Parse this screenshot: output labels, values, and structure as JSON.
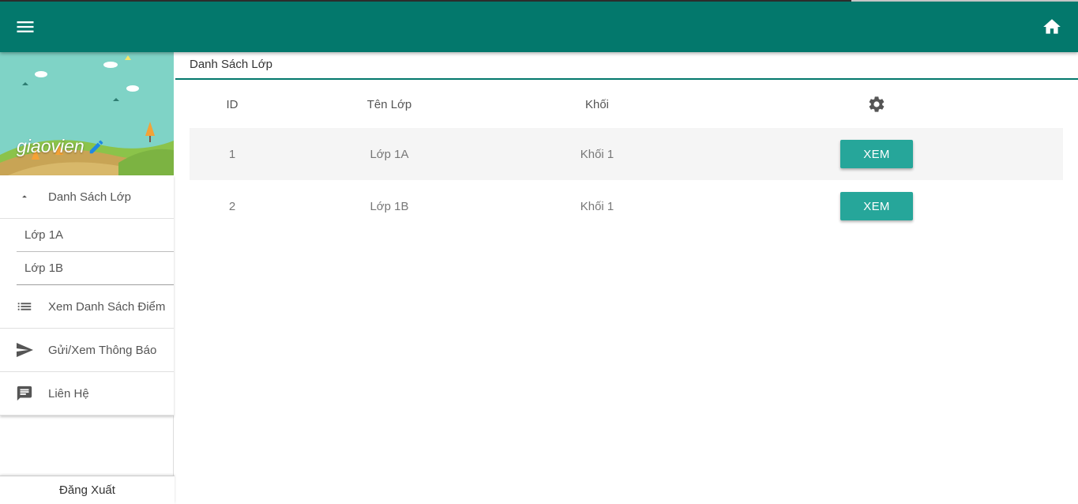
{
  "user": {
    "name": "giaovien"
  },
  "sidebar": {
    "items": [
      {
        "label": "Danh Sách Lớp",
        "icon": "arrow-up-icon"
      },
      {
        "label": "Xem Danh Sách Điểm",
        "icon": "list-icon"
      },
      {
        "label": "Gửi/Xem Thông Báo",
        "icon": "send-icon"
      },
      {
        "label": "Liên Hệ",
        "icon": "message-icon"
      }
    ],
    "subitems": [
      {
        "label": "Lớp 1A"
      },
      {
        "label": "Lớp 1B"
      }
    ],
    "logout_label": "Đăng Xuất"
  },
  "main": {
    "title": "Danh Sách Lớp",
    "table": {
      "headers": [
        "ID",
        "Tên Lớp",
        "Khối"
      ],
      "settings_icon": "gear-icon",
      "rows": [
        {
          "id": "1",
          "name": "Lớp 1A",
          "grade": "Khối 1",
          "action": "XEM"
        },
        {
          "id": "2",
          "name": "Lớp 1B",
          "grade": "Khối 1",
          "action": "XEM"
        }
      ]
    }
  },
  "colors": {
    "appbar": "#03786c",
    "button": "#26a69a",
    "row_shade": "#f5f5f5"
  }
}
